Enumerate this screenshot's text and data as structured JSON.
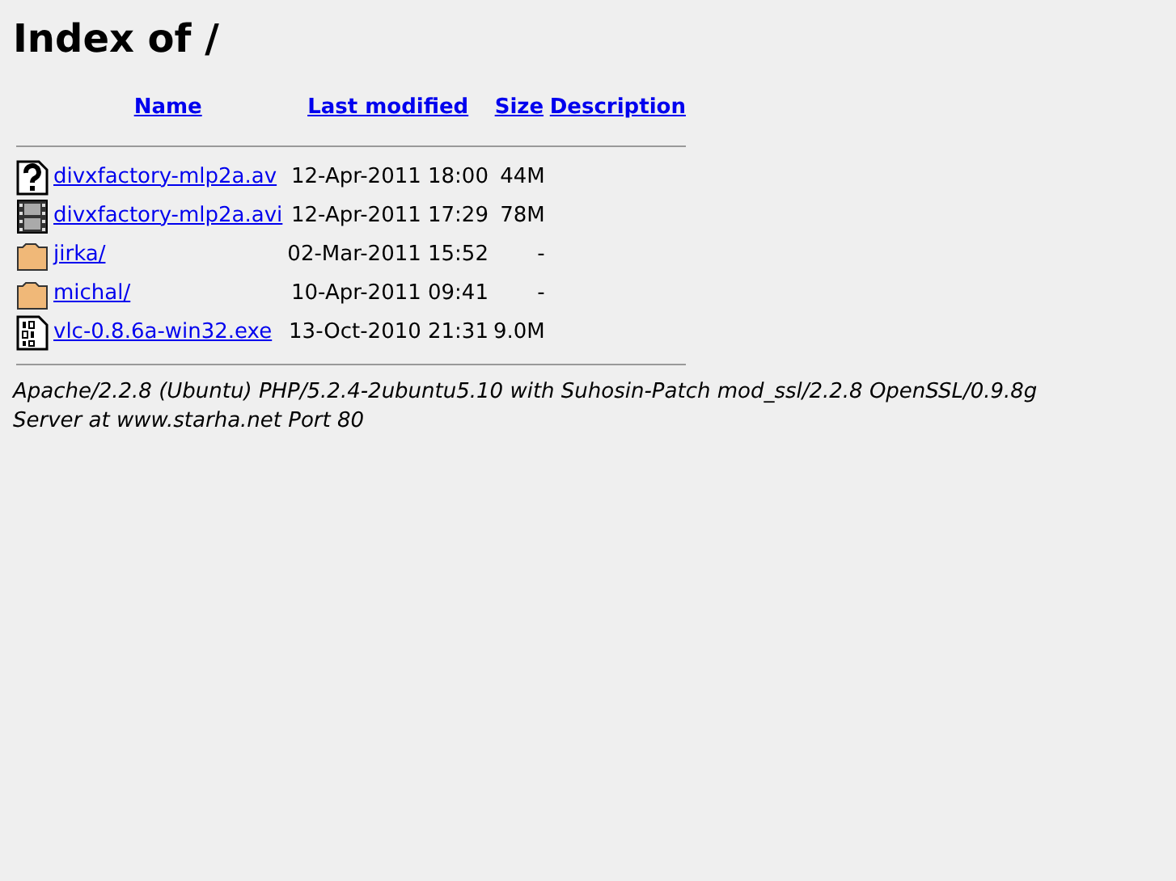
{
  "title": "Index of /",
  "table": {
    "columns": [
      "Name",
      "Last modified",
      "Size",
      "Description"
    ],
    "rows": [
      {
        "kind": "unknown",
        "name": "divxfactory-mlp2a.av",
        "modified": "12-Apr-2011 18:00",
        "size": "44M"
      },
      {
        "kind": "video",
        "name": "divxfactory-mlp2a.avi",
        "modified": "12-Apr-2011 17:29",
        "size": "78M"
      },
      {
        "kind": "folder",
        "name": "jirka/",
        "modified": "02-Mar-2011 15:52",
        "size": "-"
      },
      {
        "kind": "folder",
        "name": "michal/",
        "modified": "10-Apr-2011 09:41",
        "size": "-"
      },
      {
        "kind": "binary",
        "name": "vlc-0.8.6a-win32.exe",
        "modified": "13-Oct-2010 21:31",
        "size": "9.0M"
      }
    ]
  },
  "server_signature": "Apache/2.2.8 (Ubuntu) PHP/5.2.4-2ubuntu5.10 with Suhosin-Patch mod_ssl/2.2.8 OpenSSL/0.9.8g Server at www.starha.net Port 80"
}
